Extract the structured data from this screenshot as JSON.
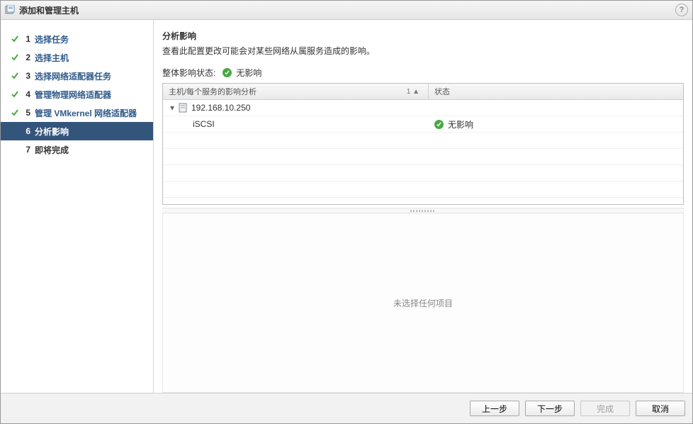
{
  "window": {
    "title": "添加和管理主机"
  },
  "steps": [
    {
      "num": "1",
      "label": "选择任务",
      "done": true,
      "active": false
    },
    {
      "num": "2",
      "label": "选择主机",
      "done": true,
      "active": false
    },
    {
      "num": "3",
      "label": "选择网络适配器任务",
      "done": true,
      "active": false
    },
    {
      "num": "4",
      "label": "管理物理网络适配器",
      "done": true,
      "active": false
    },
    {
      "num": "5",
      "label": "管理 VMkernel 网络适配器",
      "done": true,
      "active": false
    },
    {
      "num": "6",
      "label": "分析影响",
      "done": false,
      "active": true
    },
    {
      "num": "7",
      "label": "即将完成",
      "done": false,
      "active": false
    }
  ],
  "main": {
    "heading": "分析影响",
    "description": "查看此配置更改可能会对某些网络从属服务造成的影响。",
    "overall_label": "整体影响状态:",
    "overall_status": "无影响",
    "table": {
      "col1_header": "主机/每个服务的影响分析",
      "col2_header": "状态",
      "sort_indicator": "1 ▲",
      "rows": [
        {
          "type": "host",
          "text": "192.168.10.250",
          "status": ""
        },
        {
          "type": "service",
          "text": "iSCSI",
          "status": "无影响"
        }
      ]
    },
    "empty_label": "未选择任何项目"
  },
  "footer": {
    "back": "上一步",
    "next": "下一步",
    "finish": "完成",
    "cancel": "取消"
  }
}
